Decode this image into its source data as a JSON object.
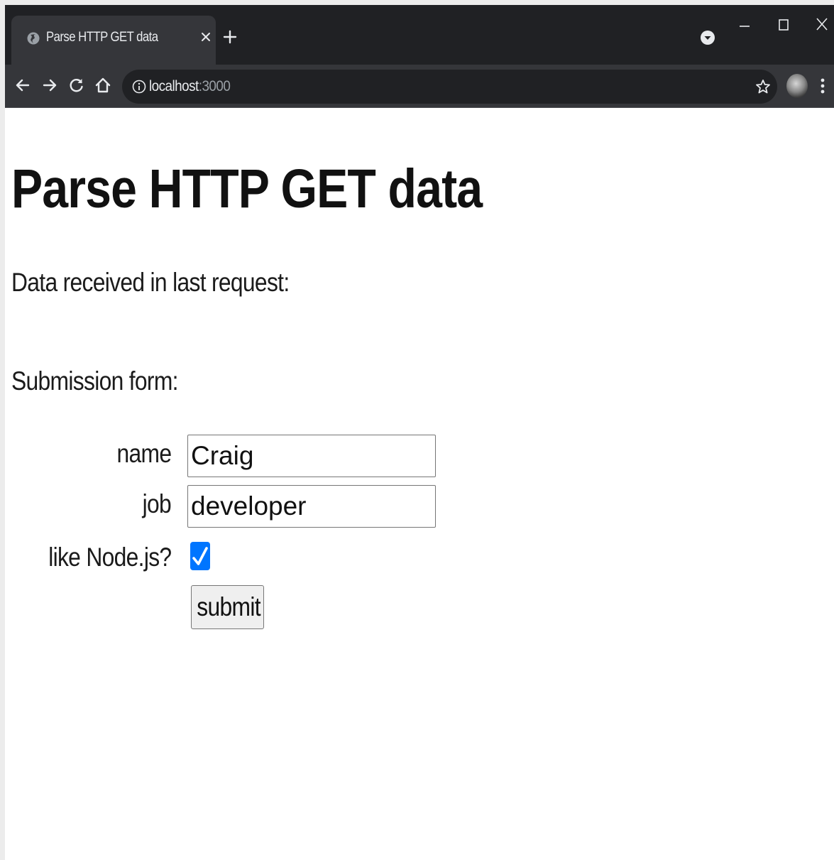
{
  "browser": {
    "tab": {
      "title": "Parse HTTP GET data"
    },
    "address_bar": {
      "host": "localhost",
      "port": ":3000"
    }
  },
  "page": {
    "title": "Parse HTTP GET data",
    "data_received_label": "Data received in last request:",
    "form_heading": "Submission form:",
    "form": {
      "name_label": "name",
      "name_value": "Craig",
      "job_label": "job",
      "job_value": "developer",
      "like_node_label": "like Node.js?",
      "like_node_checked": true,
      "submit_label": "submit"
    }
  },
  "colors": {
    "tab_strip": "#202124",
    "toolbar": "#35363a",
    "checkbox_accent": "#0075ff"
  },
  "icons": [
    "globe-icon",
    "close-icon",
    "plus-icon",
    "chevron-down-icon",
    "minimize-icon",
    "maximize-icon",
    "window-close-icon",
    "back-arrow-icon",
    "forward-arrow-icon",
    "reload-icon",
    "home-icon",
    "info-icon",
    "star-icon",
    "kebab-menu-icon",
    "checkmark-icon"
  ]
}
